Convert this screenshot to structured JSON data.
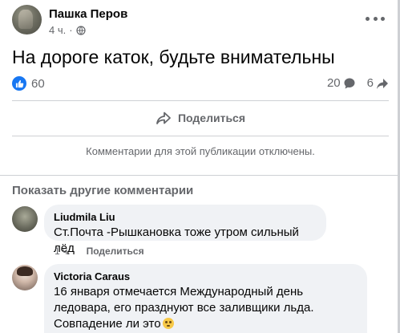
{
  "post": {
    "author": "Пашка Перов",
    "time": "4 ч.",
    "dot": "·",
    "text": "На дороге каток, будьте внимательны",
    "likes": "60",
    "comments_count": "20",
    "shares_count": "6",
    "share_label": "Поделиться",
    "comments_disabled": "Комментарии для этой публикации отключены."
  },
  "comments": {
    "more_label": "Показать другие комментарии",
    "items": [
      {
        "name": "Liudmila Liu",
        "text": "Ст.Почта -Рышкановка тоже утром сильный лёд",
        "time": "1 ч.",
        "share": "Поделиться"
      },
      {
        "name": "Victoria Caraus",
        "line1": "16 января отмечается Международный день",
        "line2": "ледовара, его празднуют все заливщики льда.",
        "line3": "Совпадение ли это"
      }
    ]
  },
  "colors": {
    "accent": "#1877f2",
    "secondary_text": "#65676b",
    "bubble": "#f0f2f5"
  },
  "icons": [
    "globe-icon",
    "more-icon",
    "like-icon",
    "comment-icon",
    "share-icon",
    "emoji-icon"
  ]
}
